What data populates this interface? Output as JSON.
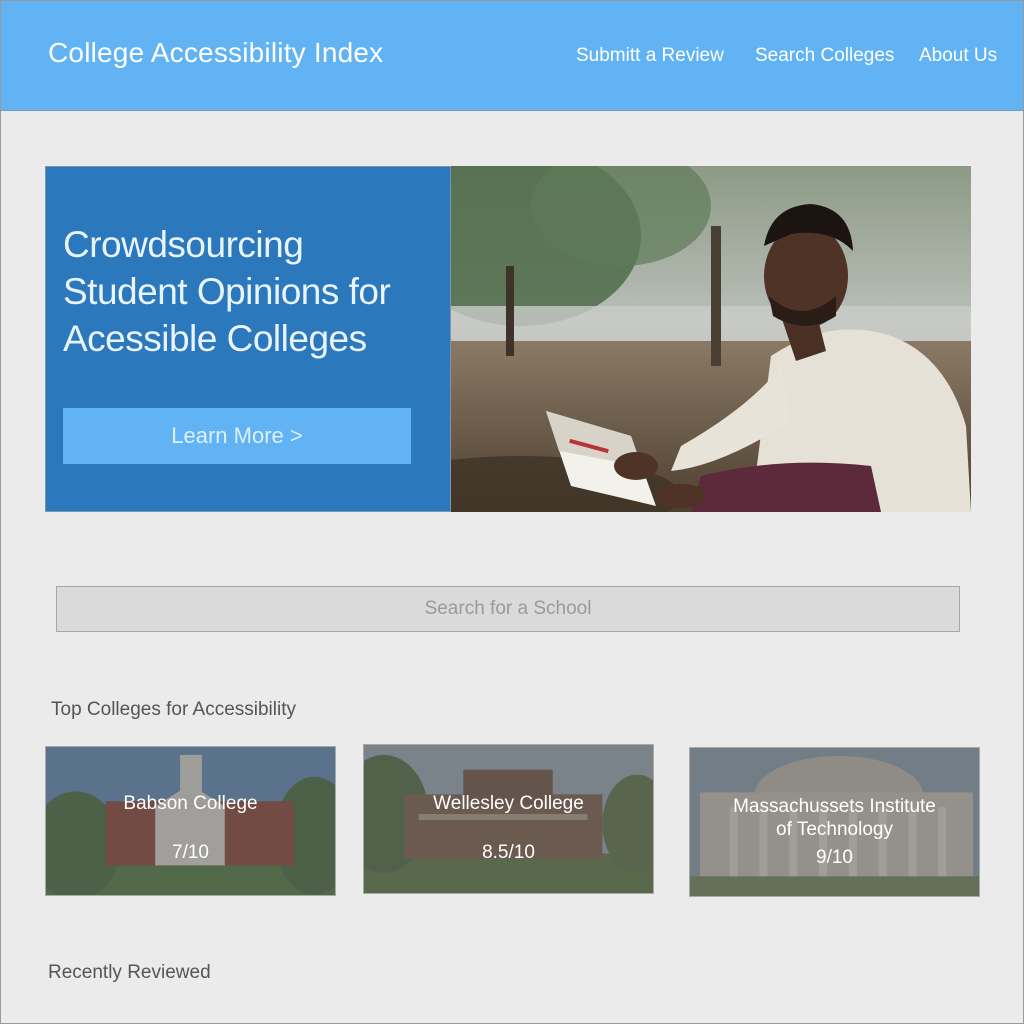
{
  "header": {
    "brand": "College Accessibility Index",
    "nav": [
      {
        "label": "Submitt a Review"
      },
      {
        "label": "Search Colleges"
      },
      {
        "label": "About Us"
      }
    ]
  },
  "hero": {
    "title_lines": [
      "Crowdsourcing",
      "Student Opinions for",
      "Acessible Colleges"
    ],
    "button_label": "Learn More >"
  },
  "search": {
    "placeholder": "Search for a School"
  },
  "top_colleges": {
    "title": "Top Colleges for Accessibility",
    "cards": [
      {
        "name": "Babson College",
        "score": "7/10"
      },
      {
        "name": "Wellesley College",
        "score": "8.5/10"
      },
      {
        "name_lines": [
          "Massachussets Institute",
          "of Technology"
        ],
        "score": "9/10"
      }
    ]
  },
  "recently_reviewed": {
    "title": "Recently Reviewed"
  },
  "colors": {
    "header": "#62b3f4",
    "hero_panel": "#2b78bd",
    "hero_button": "#62b3f4",
    "page_bg": "#ebebeb"
  }
}
